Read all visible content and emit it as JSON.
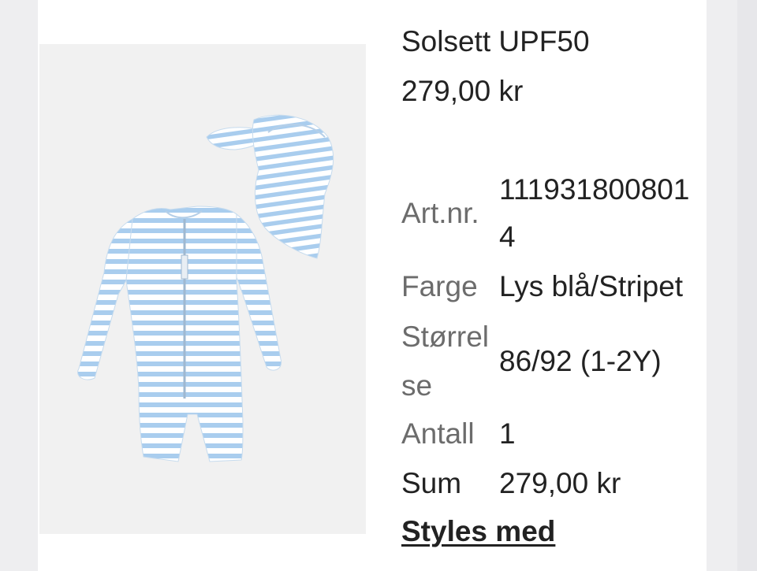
{
  "product": {
    "title": "Solsett UPF50",
    "price": "279,00 kr",
    "image_alt": "Light blue striped UPF50 swim set with long-sleeve suit and sun hat"
  },
  "details": {
    "article_label": "Art.nr.",
    "article_value_line1": "111931800801",
    "article_value_line2": "4",
    "color_label": "Farge",
    "color_value": "Lys blå/Stripet",
    "size_label_line1": "Størrel",
    "size_label_line2": "se",
    "size_value": "86/92 (1-2Y)",
    "quantity_label": "Antall",
    "quantity_value": "1",
    "sum_label": "Sum",
    "sum_value": "279,00 kr"
  },
  "links": {
    "styles_with": "Styles med"
  },
  "colors": {
    "stripe_blue": "#a9cdee",
    "label_gray": "#6c6c6c",
    "text_dark": "#222222"
  }
}
